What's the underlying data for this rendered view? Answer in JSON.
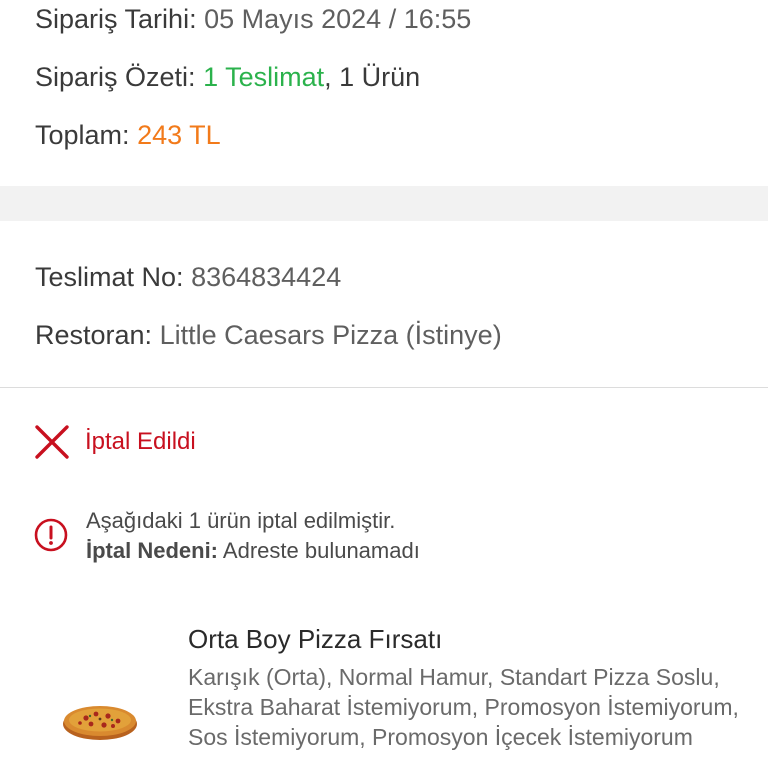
{
  "order": {
    "date_label": "Sipariş Tarihi:",
    "date_value": "05 Mayıs 2024 / 16:55",
    "summary_label": "Sipariş Özeti:",
    "summary_delivery": "1 Teslimat",
    "summary_items": ", 1 Ürün",
    "total_label": "Toplam:",
    "total_value": "243 TL"
  },
  "delivery": {
    "number_label": "Teslimat No:",
    "number_value": "8364834424",
    "restaurant_label": "Restoran:",
    "restaurant_value": "Little Caesars Pizza (İstinye)"
  },
  "status": {
    "icon": "close-icon",
    "text": "İptal Edildi",
    "color": "#c8101f"
  },
  "notice": {
    "icon": "info-icon",
    "message": "Aşağıdaki 1 ürün iptal edilmiştir.",
    "reason_label": "İptal Nedeni:",
    "reason_value": " Adreste bulunamadı"
  },
  "product": {
    "icon": "pizza-image",
    "name": "Orta Boy Pizza Fırsatı",
    "description": "Karışık (Orta), Normal Hamur, Standart Pizza Soslu, Ekstra Baharat İstemiyorum, Promosyon İstemiyorum, Sos İstemiyorum, Promosyon İçecek İstemiyorum"
  },
  "colors": {
    "green": "#2bb24c",
    "orange": "#f27a1a",
    "red": "#c8101f"
  }
}
